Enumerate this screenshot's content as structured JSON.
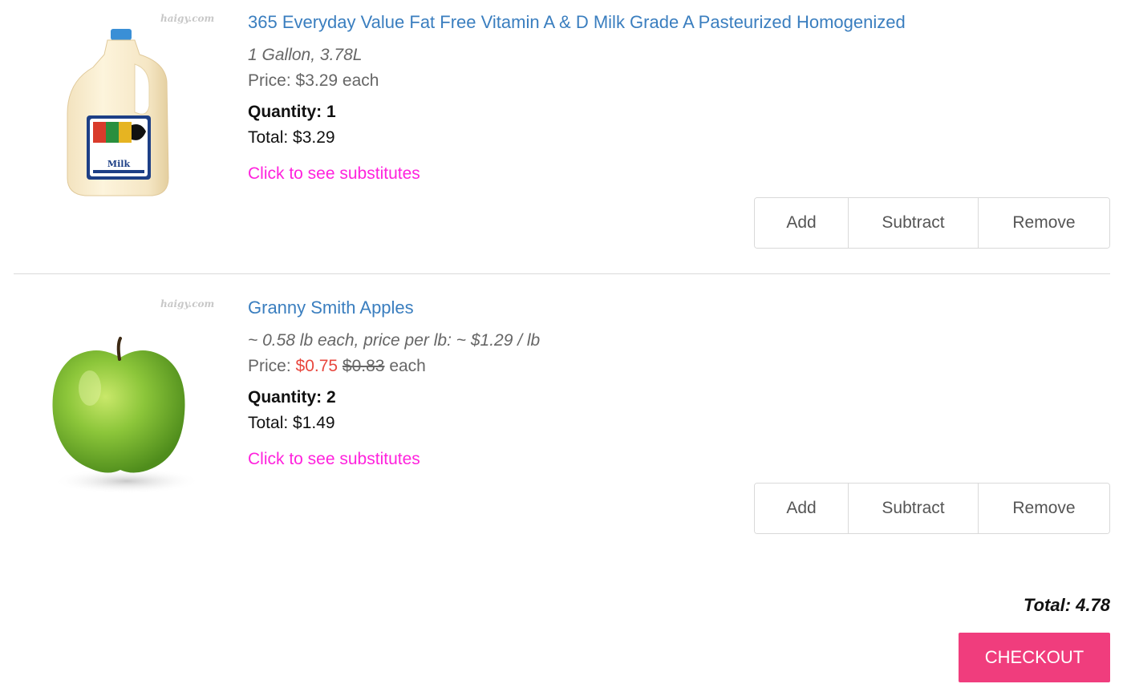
{
  "cart": {
    "items": [
      {
        "image_watermark": "haigy.com",
        "image_label": "Milk",
        "name": "365 Everyday Value Fat Free Vitamin A & D Milk Grade A Pasteurized Homogenized",
        "size": "1 Gallon, 3.78L",
        "price_prefix": "Price: ",
        "price": "$3.29",
        "price_suffix": " each",
        "quantity": "Quantity: 1",
        "total": "Total: $3.29",
        "substitutes_link": "Click to see substitutes",
        "buttons": {
          "add": "Add",
          "subtract": "Subtract",
          "remove": "Remove"
        }
      },
      {
        "image_watermark": "haigy.com",
        "name": "Granny Smith Apples",
        "size": "~ 0.58 lb each, price per lb: ~ $1.29 / lb",
        "price_prefix": "Price: ",
        "sale_price": "$0.75",
        "original_price": "$0.83",
        "price_suffix": " each",
        "quantity": "Quantity: 2",
        "total": "Total: $1.49",
        "substitutes_link": "Click to see substitutes",
        "buttons": {
          "add": "Add",
          "subtract": "Subtract",
          "remove": "Remove"
        }
      }
    ],
    "grand_total": "Total: 4.78",
    "checkout_label": "CHECKOUT"
  },
  "colors": {
    "link": "#3a7ebf",
    "substitutes": "#ff22dd",
    "sale": "#e8483f",
    "checkout": "#f03d7d"
  },
  "icons": [
    "milk-jug-image",
    "green-apple-image"
  ]
}
